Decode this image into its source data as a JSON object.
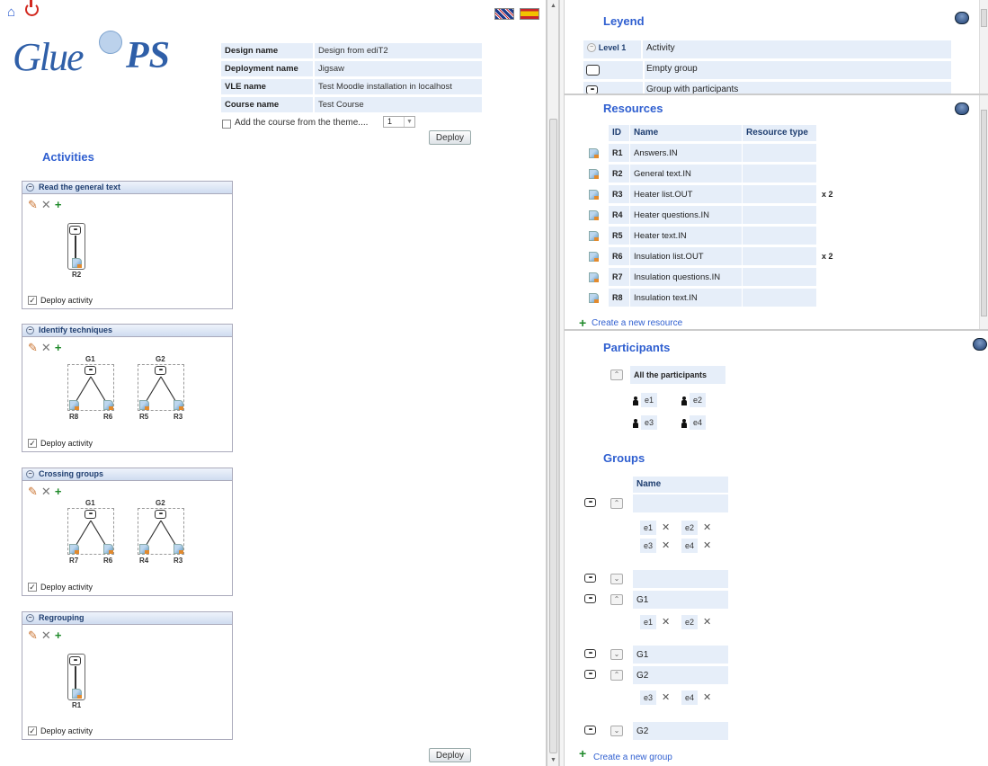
{
  "logo": {
    "text_main": "Glue",
    "text_ps": "PS"
  },
  "flags": {
    "en": "English",
    "es": "Español"
  },
  "design_info": [
    {
      "label": "Design name",
      "value": "Design from ediT2"
    },
    {
      "label": "Deployment name",
      "value": "Jigsaw"
    },
    {
      "label": "VLE name",
      "value": "Test Moodle installation in localhost"
    },
    {
      "label": "Course name",
      "value": "Test Course"
    }
  ],
  "add_course": {
    "label": "Add the course from the theme....",
    "select_value": "1"
  },
  "deploy_label": "Deploy",
  "activities_title": "Activities",
  "deploy_activity_label": "Deploy activity",
  "activities": [
    {
      "title": "Read the general text",
      "groups": [],
      "resources": [
        "R2"
      ]
    },
    {
      "title": "Identify techniques",
      "groups": [
        {
          "name": "G1",
          "resources": [
            "R8",
            "R6"
          ]
        },
        {
          "name": "G2",
          "resources": [
            "R5",
            "R3"
          ]
        }
      ]
    },
    {
      "title": "Crossing groups",
      "groups": [
        {
          "name": "G1",
          "resources": [
            "R7",
            "R6"
          ]
        },
        {
          "name": "G2",
          "resources": [
            "R4",
            "R3"
          ]
        }
      ]
    },
    {
      "title": "Regrouping",
      "groups": [],
      "resources": [
        "R1"
      ]
    }
  ],
  "legend": {
    "title": "Leyend",
    "level_label": "Level 1",
    "rows": [
      "Activity",
      "Empty group",
      "Group with participants"
    ]
  },
  "resources": {
    "title": "Resources",
    "headers": {
      "id": "ID",
      "name": "Name",
      "type": "Resource type"
    },
    "rows": [
      {
        "id": "R1",
        "name": "Answers.IN",
        "mult": ""
      },
      {
        "id": "R2",
        "name": "General text.IN",
        "mult": ""
      },
      {
        "id": "R3",
        "name": "Heater list.OUT",
        "mult": "x 2"
      },
      {
        "id": "R4",
        "name": "Heater questions.IN",
        "mult": ""
      },
      {
        "id": "R5",
        "name": "Heater text.IN",
        "mult": ""
      },
      {
        "id": "R6",
        "name": "Insulation list.OUT",
        "mult": "x 2"
      },
      {
        "id": "R7",
        "name": "Insulation questions.IN",
        "mult": ""
      },
      {
        "id": "R8",
        "name": "Insulation text.IN",
        "mult": ""
      }
    ],
    "create_label": "Create a new resource"
  },
  "participants": {
    "title": "Participants",
    "all_label": "All the participants",
    "list": [
      "e1",
      "e2",
      "e3",
      "e4"
    ]
  },
  "groups": {
    "title": "Groups",
    "name_header": "Name",
    "g_g1": "G1",
    "g_g2": "G2",
    "p": [
      "e1",
      "e2",
      "e3",
      "e4"
    ],
    "create_label": "Create a new group"
  }
}
